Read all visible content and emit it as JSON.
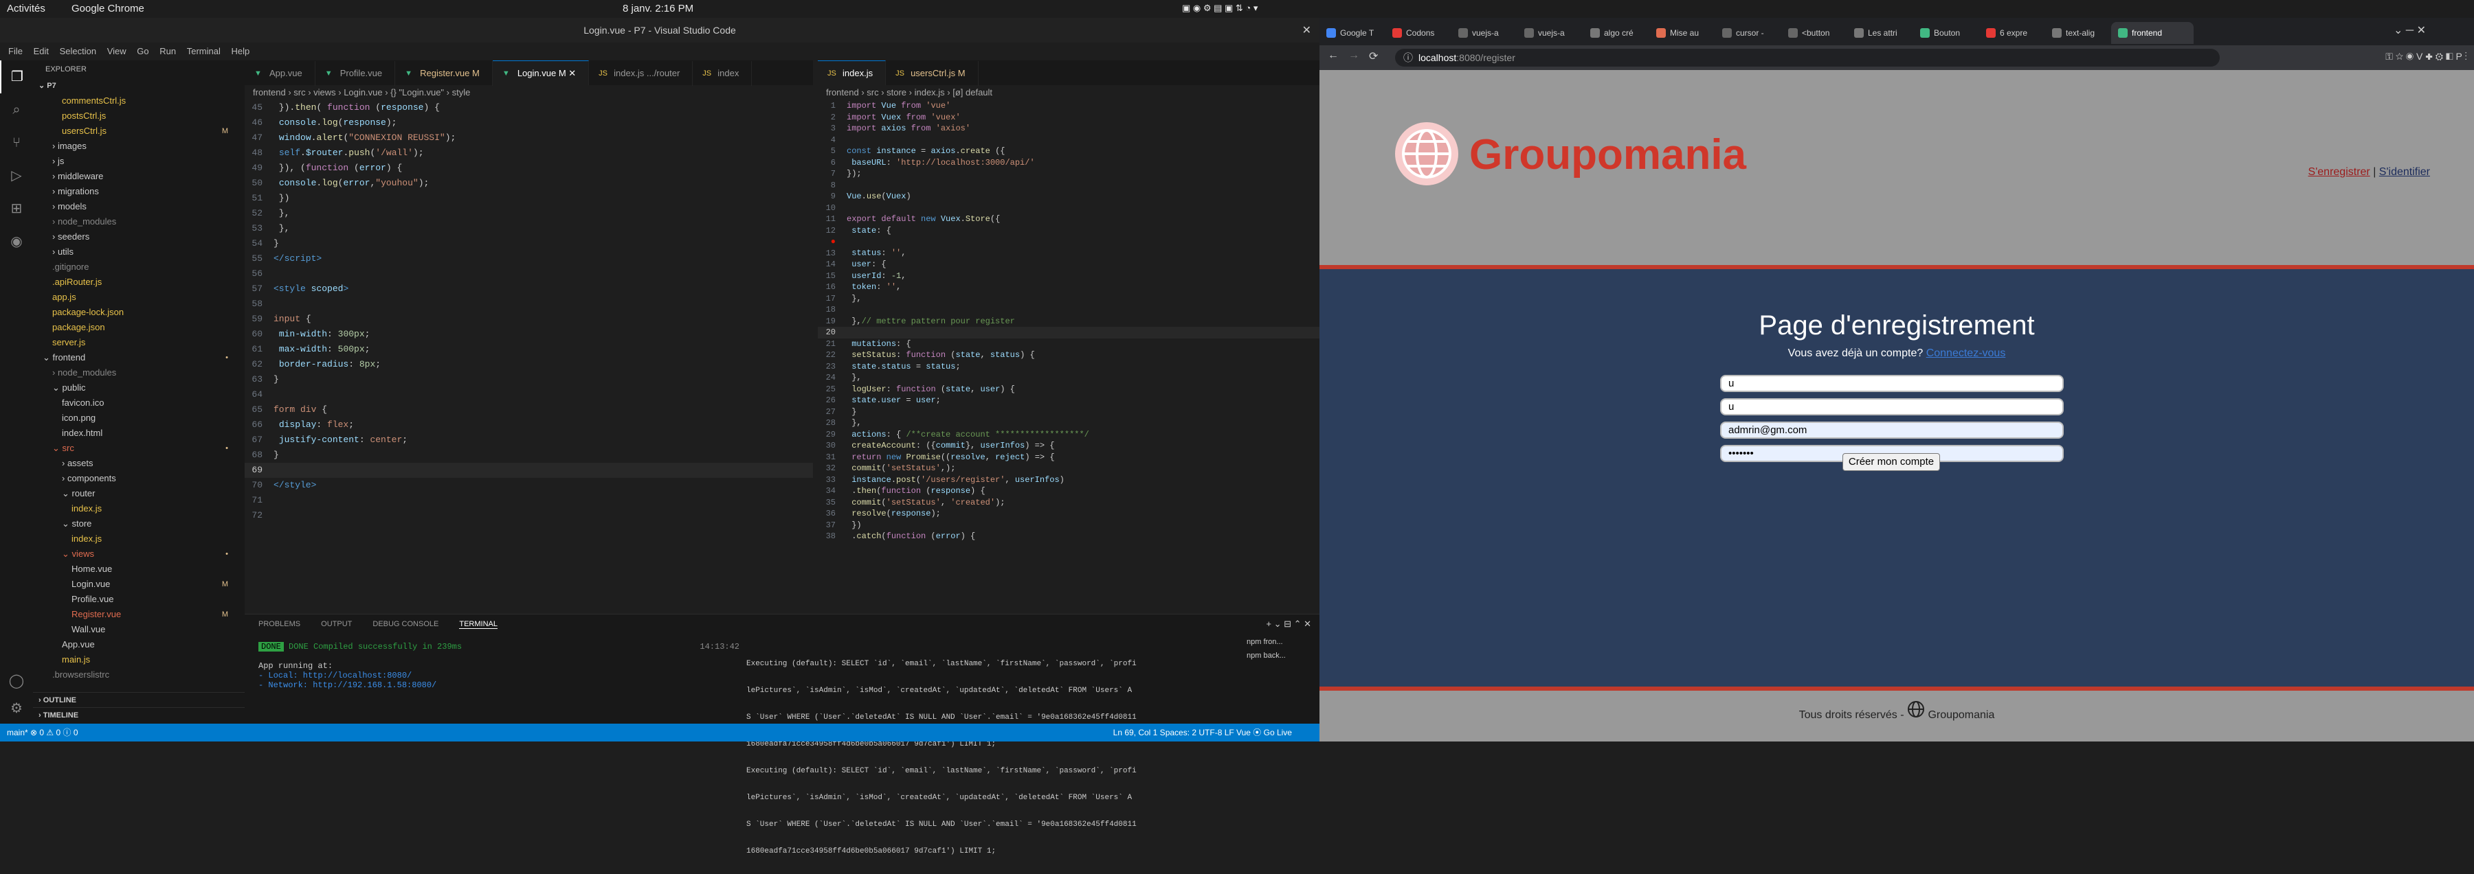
{
  "gnome": {
    "activities": "Activités",
    "app": "Google Chrome",
    "date": "8 janv.  2:16 PM"
  },
  "vscode": {
    "title": "Login.vue - P7 - Visual Studio Code",
    "menu": [
      "File",
      "Edit",
      "Selection",
      "View",
      "Go",
      "Run",
      "Terminal",
      "Help"
    ],
    "explorer_label": "EXPLORER",
    "project": "P7",
    "tree": [
      {
        "n": "commentsCtrl.js",
        "i": 2,
        "c": "#e8c24a"
      },
      {
        "n": "postsCtrl.js",
        "i": 2,
        "c": "#e8c24a"
      },
      {
        "n": "usersCtrl.js",
        "i": 2,
        "c": "#e8c24a",
        "m": "M"
      },
      {
        "n": "› images",
        "i": 1,
        "c": "#ccc"
      },
      {
        "n": "› js",
        "i": 1,
        "c": "#ccc"
      },
      {
        "n": "› middleware",
        "i": 1,
        "c": "#ccc"
      },
      {
        "n": "› migrations",
        "i": 1,
        "c": "#ccc"
      },
      {
        "n": "› models",
        "i": 1,
        "c": "#ccc"
      },
      {
        "n": "› node_modules",
        "i": 1,
        "c": "#888"
      },
      {
        "n": "› seeders",
        "i": 1,
        "c": "#ccc"
      },
      {
        "n": "› utils",
        "i": 1,
        "c": "#ccc"
      },
      {
        "n": ".gitignore",
        "i": 1,
        "c": "#888"
      },
      {
        "n": ".apiRouter.js",
        "i": 1,
        "c": "#e8c24a"
      },
      {
        "n": "app.js",
        "i": 1,
        "c": "#e8c24a"
      },
      {
        "n": "package-lock.json",
        "i": 1,
        "c": "#e8c24a"
      },
      {
        "n": "package.json",
        "i": 1,
        "c": "#e8c24a"
      },
      {
        "n": "server.js",
        "i": 1,
        "c": "#e8c24a"
      },
      {
        "n": "⌄ frontend",
        "i": 0,
        "c": "#ccc",
        "m": "•"
      },
      {
        "n": "› node_modules",
        "i": 1,
        "c": "#888"
      },
      {
        "n": "⌄ public",
        "i": 1,
        "c": "#ccc"
      },
      {
        "n": "favicon.ico",
        "i": 2,
        "c": "#ccc"
      },
      {
        "n": "icon.png",
        "i": 2,
        "c": "#ccc"
      },
      {
        "n": "index.html",
        "i": 2,
        "c": "#ccc"
      },
      {
        "n": "⌄ src",
        "i": 1,
        "c": "#e06c50",
        "m": "•"
      },
      {
        "n": "› assets",
        "i": 2,
        "c": "#ccc"
      },
      {
        "n": "› components",
        "i": 2,
        "c": "#ccc"
      },
      {
        "n": "⌄ router",
        "i": 2,
        "c": "#ccc"
      },
      {
        "n": "index.js",
        "i": 3,
        "c": "#e8c24a"
      },
      {
        "n": "⌄ store",
        "i": 2,
        "c": "#ccc"
      },
      {
        "n": "index.js",
        "i": 3,
        "c": "#e8c24a"
      },
      {
        "n": "⌄ views",
        "i": 2,
        "c": "#e06c50",
        "m": "•"
      },
      {
        "n": "Home.vue",
        "i": 3,
        "c": "#ccc"
      },
      {
        "n": "Login.vue",
        "i": 3,
        "c": "#ccc",
        "m": "M"
      },
      {
        "n": "Profile.vue",
        "i": 3,
        "c": "#ccc"
      },
      {
        "n": "Register.vue",
        "i": 3,
        "c": "#e06c50",
        "m": "M"
      },
      {
        "n": "Wall.vue",
        "i": 3,
        "c": "#ccc"
      },
      {
        "n": "App.vue",
        "i": 2,
        "c": "#ccc"
      },
      {
        "n": "main.js",
        "i": 2,
        "c": "#e8c24a"
      },
      {
        "n": ".browserslistrc",
        "i": 1,
        "c": "#888"
      }
    ],
    "outline": "OUTLINE",
    "timeline": "TIMELINE",
    "tabs1": [
      "App.vue",
      "Profile.vue",
      "Register.vue M",
      "Login.vue M",
      "index.js .../router",
      "index"
    ],
    "bc1": "frontend › src › views › Login.vue › {} \"Login.vue\" › style",
    "tabs2": [
      "index.js",
      "usersCtrl.js M"
    ],
    "bc2": "frontend › src › store › index.js › [ø] default",
    "panel_tabs": [
      "PROBLEMS",
      "OUTPUT",
      "DEBUG CONSOLE",
      "TERMINAL"
    ],
    "term1": [
      "DONE  Compiled successfully in 239ms",
      "14:13:42",
      "",
      "  App running at:",
      "  - Local:   http://localhost:8080/",
      "  - Network: http://192.168.1.58:8080/"
    ],
    "term2": [
      "Executing (default): SELECT `id`, `email`, `lastName`, `firstName`, `password`, `profi",
      "lePictures`, `isAdmin`, `isMod`, `createdAt`, `updatedAt`, `deletedAt` FROM `Users` A",
      "S `User` WHERE (`User`.`deletedAt` IS NULL AND `User`.`email` = '9e0a168362e45ff4d0811",
      "1680eadfa71cce34958ff4d6be0b5a066017 9d7caf1') LIMIT 1;",
      "Executing (default): SELECT `id`, `email`, `lastName`, `firstName`, `password`, `profi",
      "lePictures`, `isAdmin`, `isMod`, `createdAt`, `updatedAt`, `deletedAt` FROM `Users` A",
      "S `User` WHERE (`User`.`deletedAt` IS NULL AND `User`.`email` = '9e0a168362e45ff4d0811",
      "1680eadfa71cce34958ff4d6be0b5a066017 9d7caf1') LIMIT 1;"
    ],
    "term_list": [
      "npm  fron...",
      "npm  back..."
    ],
    "status_left": "main*  ⊗ 0 ⚠ 0  ⓘ 0",
    "status_right": "Ln 69, Col 1   Spaces: 2   UTF-8   LF   Vue   ⦿ Go Live"
  },
  "chrome": {
    "tabs": [
      "Google T",
      "Codons",
      "vuejs-a",
      "vuejs-a",
      "algo cré",
      "Mise au",
      "cursor -",
      "<button",
      "Les attri",
      "Bouton",
      "6 expre",
      "text-alig",
      "frontend"
    ],
    "url_host": "localhost",
    "url_rest": ":8080/register"
  },
  "site": {
    "logo": "Groupomania",
    "nav_register": "S'enregistrer",
    "nav_sep": " | ",
    "nav_login": "S'identifier",
    "title": "Page d'enregistrement",
    "sub_text": "Vous avez déjà un compte? ",
    "sub_link": "Connectez-vous",
    "fields": [
      "u",
      "u",
      "admrin@gm.com",
      "•••••••"
    ],
    "submit": "Créer mon compte",
    "footer": "Tous droits réservés - ",
    "footer_brand": "Groupomania"
  }
}
